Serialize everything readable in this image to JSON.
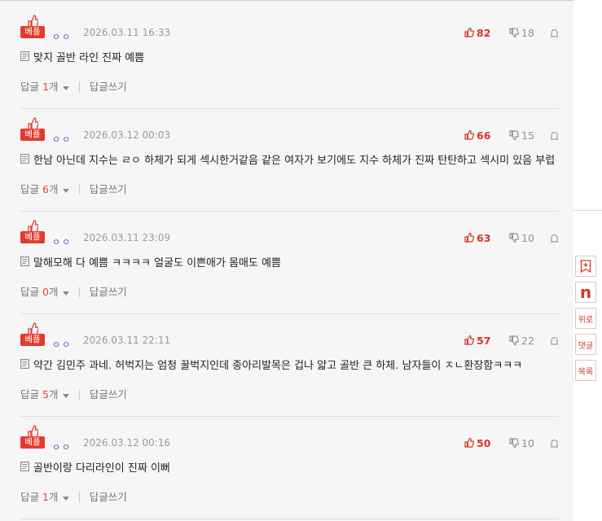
{
  "comments": [
    {
      "badge": "베플",
      "user": "ㅇㅇ",
      "date": "2026.03.11 16:33",
      "up": "82",
      "down": "18",
      "text": "맞지 골반 라인 진짜 예쁨",
      "reply_label": "답글",
      "reply_count": "1",
      "reply_unit": "개",
      "write_label": "답글쓰기"
    },
    {
      "badge": "베플",
      "user": "ㅇㅇ",
      "date": "2026.03.12 00:03",
      "up": "66",
      "down": "15",
      "text": "한남 아닌데 지수는 ㄹㅇ 하체가 되게 섹시한거같음 같은 여자가 보기에도 지수 하체가 진짜 탄탄하고 섹시미 있음 부럽",
      "reply_label": "답글",
      "reply_count": "6",
      "reply_unit": "개",
      "write_label": "답글쓰기"
    },
    {
      "badge": "베플",
      "user": "ㅇㅇ",
      "date": "2026.03.11 23:09",
      "up": "63",
      "down": "10",
      "text": "말해모해 다 예쁨 ㅋㅋㅋㅋ 얼굴도 이쁜애가 몸매도 예쁨",
      "reply_label": "답글",
      "reply_count": "0",
      "reply_unit": "개",
      "write_label": "답글쓰기"
    },
    {
      "badge": "베플",
      "user": "ㅇㅇ",
      "date": "2026.03.11 22:11",
      "up": "57",
      "down": "22",
      "text": "약간 김민주 과네. 허벅지는 엄청 꿀벅지인데 종아리발목은 겁나 얇고 골반 큰 하체. 남자들이 ㅈㄴ환장함ㅋㅋㅋ",
      "reply_label": "답글",
      "reply_count": "5",
      "reply_unit": "개",
      "write_label": "답글쓰기"
    },
    {
      "badge": "베플",
      "user": "ㅇㅇ",
      "date": "2026.03.12 00:16",
      "up": "50",
      "down": "10",
      "text": "골반이랑 다리라인이 진짜 이뻐",
      "reply_label": "답글",
      "reply_count": "1",
      "reply_unit": "개",
      "write_label": "답글쓰기"
    }
  ],
  "sidebar": {
    "bookmark_icon": "bookmark-plus-icon",
    "n_label": "n",
    "top_label": "위로",
    "comments_label": "댓글",
    "list_label": "목록"
  },
  "colors": {
    "accent": "#e23b2e",
    "user": "#3d63b8",
    "reply_count": "#e0463a"
  }
}
